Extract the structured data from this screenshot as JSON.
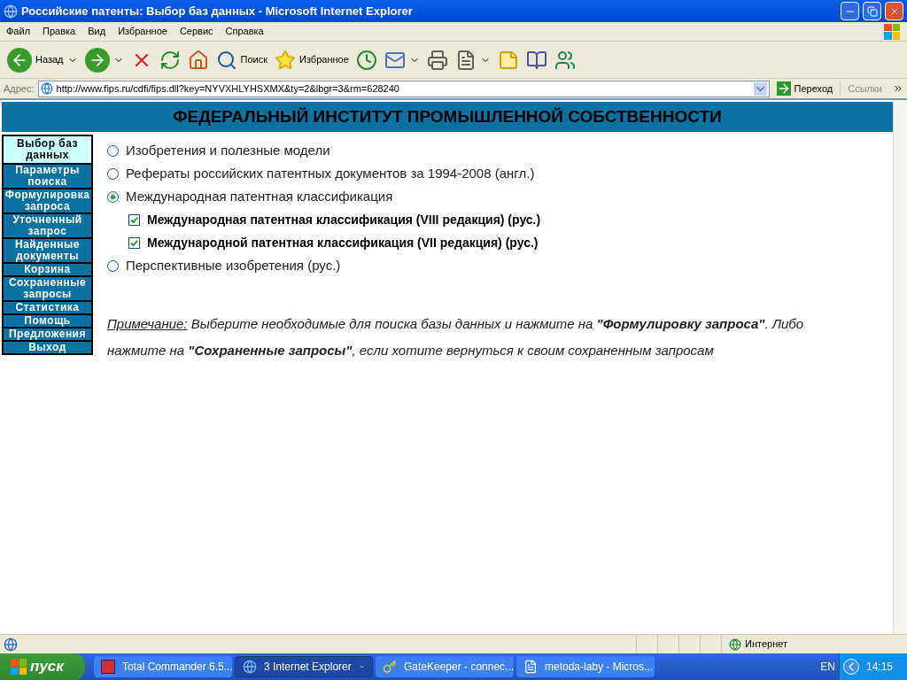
{
  "window": {
    "title": "Российские патенты: Выбор баз данных - Microsoft Internet Explorer"
  },
  "menu": [
    "Файл",
    "Правка",
    "Вид",
    "Избранное",
    "Сервис",
    "Справка"
  ],
  "toolbar": [
    {
      "kind": "back",
      "label": "Назад"
    },
    {
      "kind": "forward"
    },
    {
      "kind": "stop"
    },
    {
      "kind": "refresh"
    },
    {
      "kind": "home"
    },
    {
      "kind": "search",
      "label": "Поиск"
    },
    {
      "kind": "favorites",
      "label": "Избранное"
    },
    {
      "kind": "history"
    },
    {
      "kind": "mail"
    },
    {
      "kind": "print"
    },
    {
      "kind": "edit"
    },
    {
      "kind": "notes"
    },
    {
      "kind": "research"
    },
    {
      "kind": "messenger"
    }
  ],
  "address": {
    "label": "Адрес:",
    "url": "http://www.fips.ru/cdfi/fips.dll?key=NYVXHLYHSXMX&ty=2&lbgr=3&rm=628240",
    "go": "Переход",
    "links": "Ссылки"
  },
  "page": {
    "heading": "ФЕДЕРАЛЬНЫЙ ИНСТИТУТ ПРОМЫШЛЕННОЙ СОБСТВЕННОСТИ",
    "nav": [
      {
        "label": "Выбор баз данных",
        "selected": true
      },
      {
        "label": "Параметры поиска",
        "selected": false
      },
      {
        "label": "Формулировка запроса",
        "selected": false
      },
      {
        "label": "Уточненный запрос",
        "selected": false
      },
      {
        "label": "Найденные документы",
        "selected": false
      },
      {
        "label": "Корзина",
        "selected": false
      },
      {
        "label": "Сохраненные запросы",
        "selected": false
      },
      {
        "label": "Статистика",
        "selected": false
      },
      {
        "label": "Помощь",
        "selected": false
      },
      {
        "label": "Предложения",
        "selected": false
      },
      {
        "label": "Выход",
        "selected": false
      }
    ],
    "databases": [
      {
        "kind": "radio",
        "label": "Изобретения и полезные модели",
        "selected": false
      },
      {
        "kind": "radio",
        "label": "Рефераты российских патентных документов за 1994-2008 (англ.)",
        "selected": false
      },
      {
        "kind": "radio",
        "label": "Международная патентная классификация",
        "selected": true,
        "children": [
          {
            "kind": "checkbox",
            "label": "Международная патентная классификация (VIII редакция) (рус.)",
            "checked": true
          },
          {
            "kind": "checkbox",
            "label": "Международной патентная классификация (VII редакция) (рус.)",
            "checked": true
          }
        ]
      },
      {
        "kind": "radio",
        "label": "Перспективные изобретения (рус.)",
        "selected": false
      }
    ],
    "note": {
      "label": "Примечание:",
      "text": "Выберите необходимые для поиска базы данных и нажмите на **\"Формулировку запроса\"**. Либо нажмите на **\"Сохраненные запросы\"**, если хотите вернуться к своим сохраненным запросам"
    }
  },
  "status_bar": {
    "zone": "Интернет"
  },
  "taskbar": {
    "start": "пуск",
    "tasks": [
      {
        "label": "Total Commander 6.5...",
        "selected": false,
        "kind": "commander"
      },
      {
        "label": "3 Internet Explorer",
        "selected": true,
        "kind": "browser"
      },
      {
        "label": "GateKeeper - connec...",
        "selected": false,
        "kind": "key"
      },
      {
        "label": "metoda-laby - Micros...",
        "selected": false,
        "kind": "word"
      }
    ],
    "language": "EN",
    "clock": "14:15"
  }
}
